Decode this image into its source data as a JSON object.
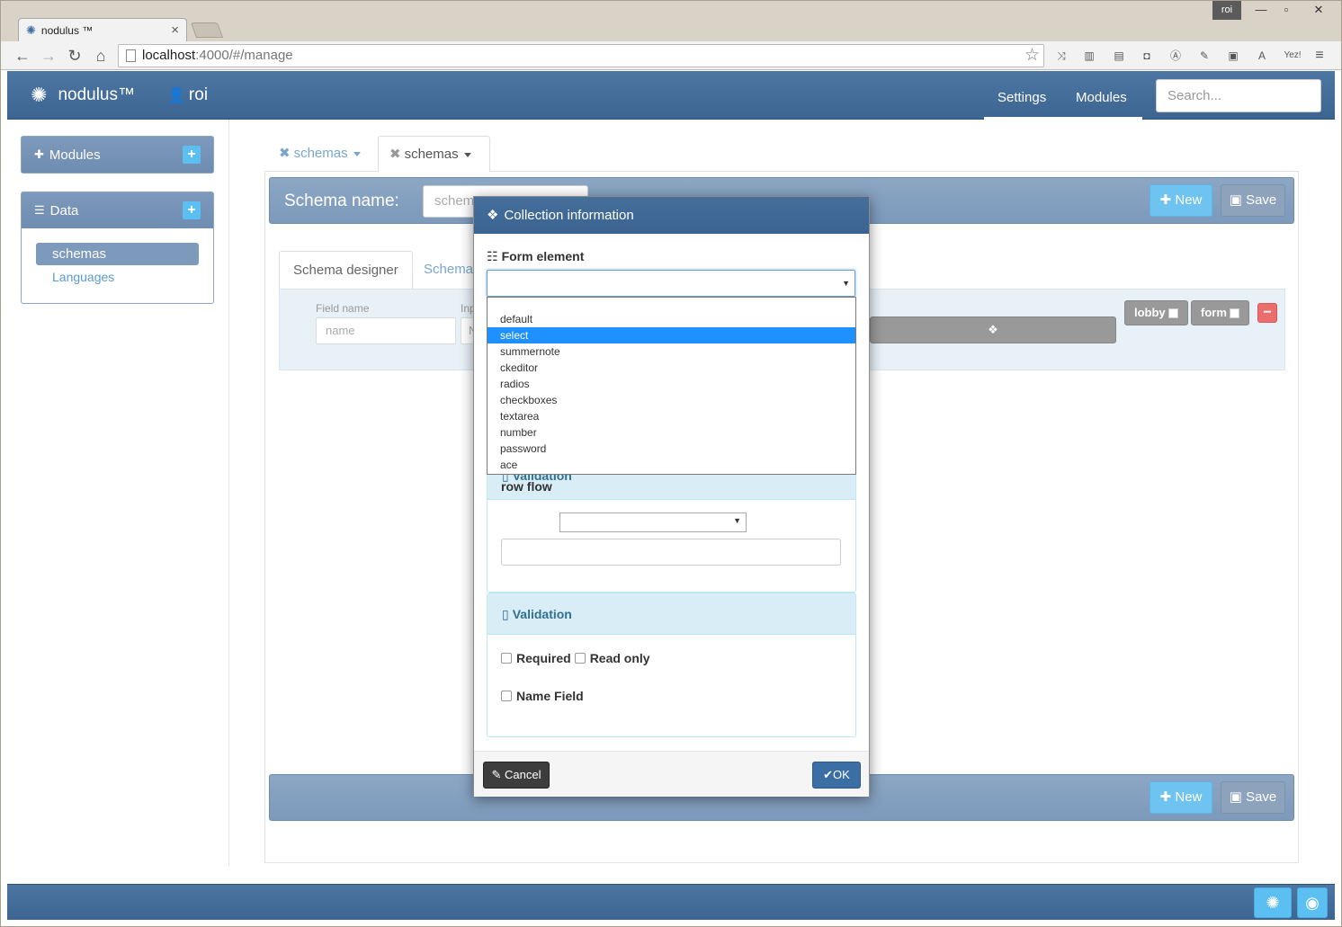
{
  "browser": {
    "tab_title": "nodulus ™",
    "tab_close": "×",
    "profile_user": "roi",
    "url_host": "localhost",
    "url_path": ":4000/#/manage",
    "ext_yez": "Yez!",
    "ext_a": "A"
  },
  "navbar": {
    "brand": "nodulus™",
    "user": "roi",
    "links": [
      "Settings",
      "Modules"
    ],
    "search_placeholder": "Search..."
  },
  "sidebar": {
    "modules_title": "Modules",
    "data_title": "Data",
    "add_label": "+",
    "items": [
      "schemas",
      "Languages"
    ]
  },
  "tabs": [
    "schemas",
    "schemas"
  ],
  "schema_bar": {
    "label": "Schema name:",
    "input_value": "schem",
    "new_label": "New",
    "save_label": "Save"
  },
  "designer": {
    "tabs": [
      "Schema designer",
      "Schema"
    ],
    "field_name_label": "Field name",
    "field_name_placeholder": "name",
    "input_label": "Inp",
    "input_placeholder": "N",
    "tags": [
      "lobby",
      "form"
    ],
    "remove_label": "−"
  },
  "bottom_bar": {
    "new_label": "New",
    "save_label": "Save"
  },
  "modal": {
    "title": "Collection information",
    "form_element_label": "Form element",
    "dropdown_options": [
      "default",
      "select",
      "summernote",
      "ckeditor",
      "radios",
      "checkboxes",
      "textarea",
      "number",
      "password",
      "ace"
    ],
    "selected_option": "select",
    "validation_partial": "Validation",
    "row_flow_label": "row flow",
    "validation_title": "Validation",
    "required_label": "Required",
    "read_only_label": "Read only",
    "name_field_label": "Name Field",
    "cancel_label": "Cancel",
    "ok_label": "OK"
  },
  "colors": {
    "navbar": "#3c6591",
    "accent_button": "#6fc3f1",
    "panel_head": "#7d99bb",
    "selected_option": "#1e90ff",
    "info_panel": "#d9edf7"
  }
}
